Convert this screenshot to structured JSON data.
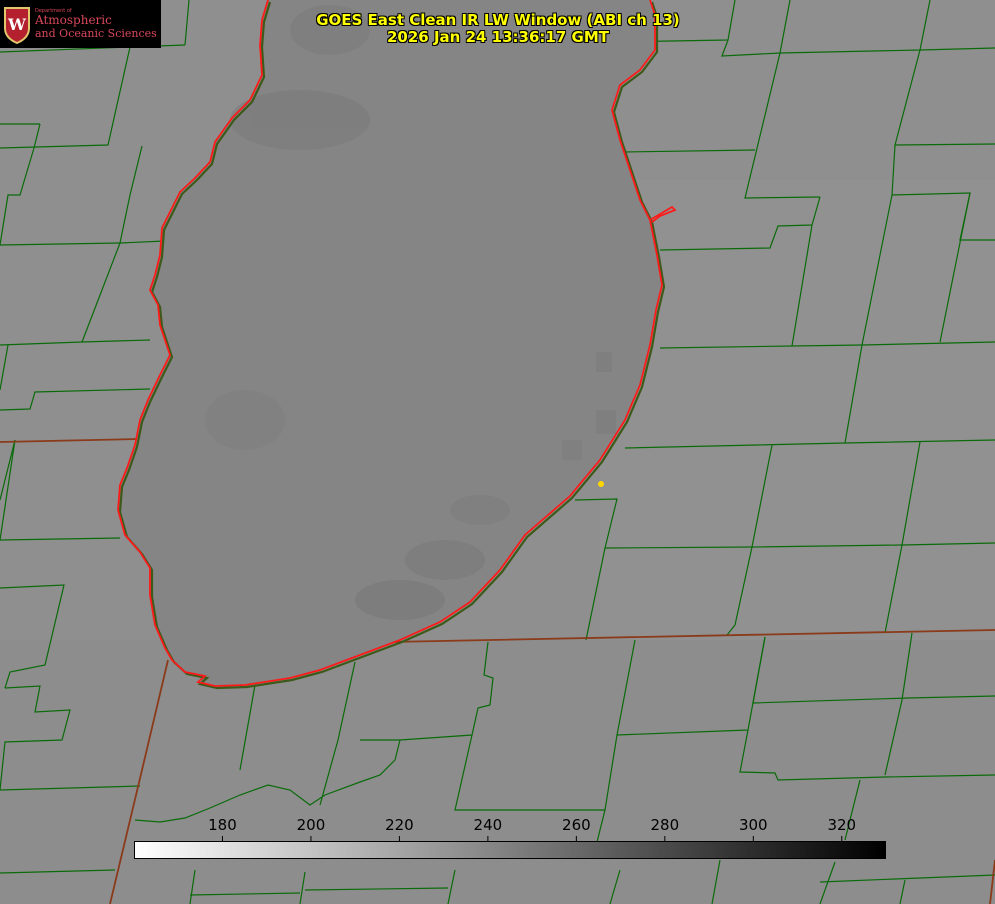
{
  "title": {
    "line1": "GOES East Clean IR LW Window (ABI ch 13)",
    "line2": "2026 Jan 24 13:36:17 GMT"
  },
  "logo": {
    "department": "Department of",
    "line1": "Atmospheric",
    "line2": "and Oceanic Sciences",
    "shield_letter": "W",
    "color": "#d8485a"
  },
  "colorbar": {
    "min": 160,
    "max": 330,
    "ticks": [
      180,
      200,
      220,
      240,
      260,
      280,
      300,
      320
    ],
    "gradient_from": "#ffffff",
    "gradient_to": "#000000",
    "tick_label_color": "#000000"
  },
  "map": {
    "land_color": "#8f8f8f",
    "lake_color": "#848484",
    "county_line_color": "#006400",
    "state_line_color": "#8b3a1a",
    "shoreline_color": "#ff0000",
    "marker_color": "#ffd700"
  }
}
